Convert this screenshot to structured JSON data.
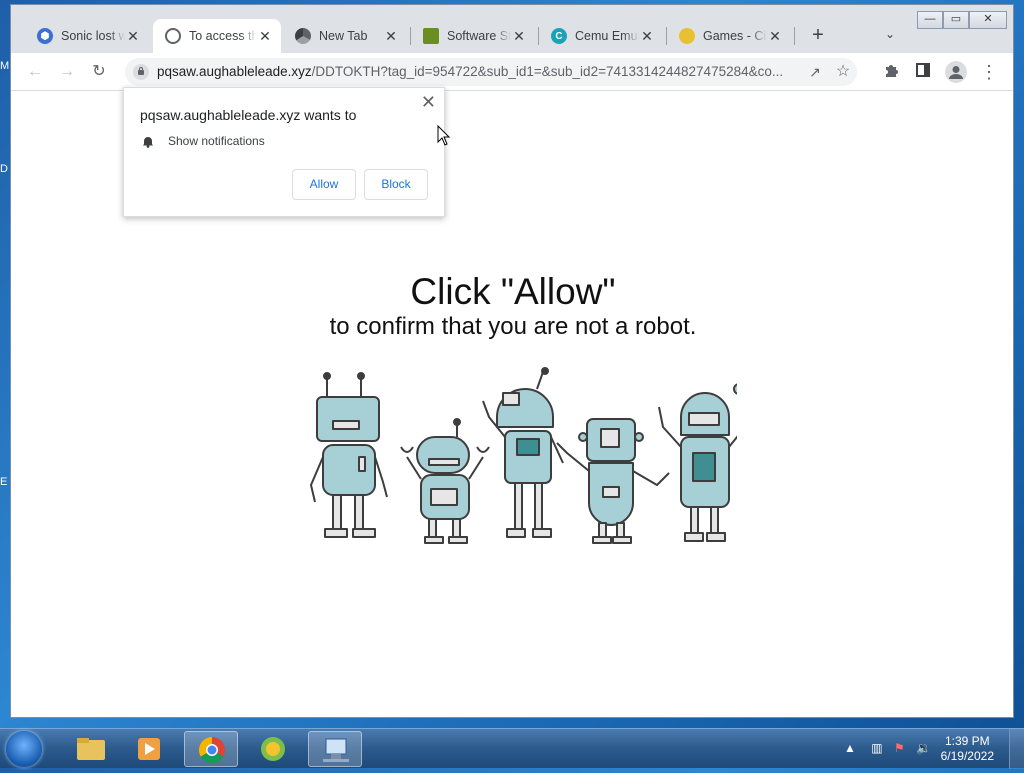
{
  "window": {
    "controls": {
      "minimize": "—",
      "maximize": "▭",
      "close": "✕"
    }
  },
  "tabs": [
    {
      "title": "Sonic lost w",
      "icon": "shield-icon",
      "color": "#3b6fd4",
      "active": false
    },
    {
      "title": "To access th",
      "icon": "globe-icon",
      "color": "#5f6368",
      "active": true
    },
    {
      "title": "New Tab",
      "icon": "chrome-icon",
      "color": "#5f6368",
      "active": false
    },
    {
      "title": "Software St",
      "icon": "software-store-icon",
      "color": "#6b8e23",
      "active": false
    },
    {
      "title": "Cemu Emul",
      "icon": "cemu-icon",
      "color": "#1aa3b8",
      "active": false
    },
    {
      "title": "Games - Cit",
      "icon": "coin-icon",
      "color": "#e8c030",
      "active": false
    }
  ],
  "toolbar": {
    "url_host": "pqsaw.aughableleade.xyz",
    "url_path": "/DDTOKTH?tag_id=954722&sub_id1=&sub_id2=7413314244827475284&co..."
  },
  "popup": {
    "title": "pqsaw.aughableleade.xyz wants to",
    "permission": "Show notifications",
    "allow": "Allow",
    "block": "Block",
    "close": "✕"
  },
  "page": {
    "headline": "Click \"Allow\"",
    "subline": "to confirm that you are not a robot."
  },
  "taskbar": {
    "time": "1:39 PM",
    "date": "6/19/2022"
  },
  "desktop_fragments": [
    "M",
    "D",
    "E"
  ]
}
